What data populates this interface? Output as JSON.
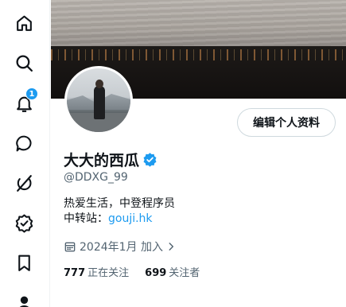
{
  "nav": {
    "items": [
      {
        "name": "home",
        "icon": "home-icon"
      },
      {
        "name": "explore",
        "icon": "search-icon"
      },
      {
        "name": "notifications",
        "icon": "bell-icon",
        "badge": "1"
      },
      {
        "name": "messages",
        "icon": "message-icon"
      },
      {
        "name": "grok",
        "icon": "grok-icon"
      },
      {
        "name": "verified",
        "icon": "verified-badge-icon"
      },
      {
        "name": "bookmarks",
        "icon": "bookmark-icon"
      },
      {
        "name": "profile",
        "icon": "person-icon"
      }
    ]
  },
  "profile": {
    "edit_label": "编辑个人资料",
    "display_name": "大大的西瓜",
    "handle": "@DDXG_99",
    "bio_line1": "热爱生活，中登程序员",
    "bio_line2_prefix": "中转站：",
    "bio_link": "gouji.hk",
    "joined": "2024年1月 加入",
    "following_count": "777",
    "following_label": "正在关注",
    "followers_count": "699",
    "followers_label": "关注者"
  },
  "colors": {
    "accent": "#1d9bf0",
    "text_primary": "#0f1419",
    "text_secondary": "#536471"
  }
}
